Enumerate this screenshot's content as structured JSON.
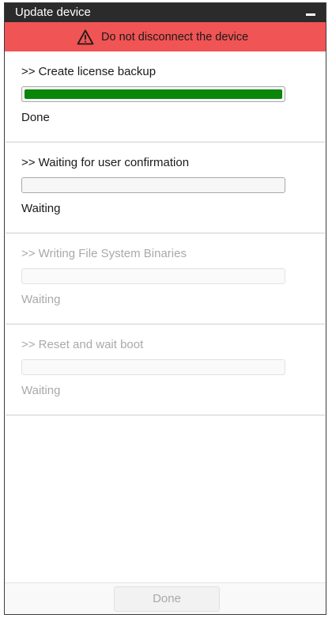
{
  "window": {
    "title": "Update device"
  },
  "warning": {
    "text": "Do not disconnect the device",
    "icon": "warning-triangle-icon",
    "background": "#f15454"
  },
  "steps": [
    {
      "title": ">> Create license backup",
      "status": "Done",
      "progress": 1.0,
      "enabled": true
    },
    {
      "title": ">> Waiting for user confirmation",
      "status": "Waiting",
      "progress": 0.0,
      "enabled": true
    },
    {
      "title": ">> Writing File System Binaries",
      "status": "Waiting",
      "progress": 0.0,
      "enabled": false
    },
    {
      "title": ">> Reset and wait boot",
      "status": "Waiting",
      "progress": 0.0,
      "enabled": false
    }
  ],
  "footer": {
    "done_label": "Done",
    "done_enabled": false
  },
  "colors": {
    "progress_fill": "#0a860a",
    "titlebar": "#2b2b2b"
  }
}
